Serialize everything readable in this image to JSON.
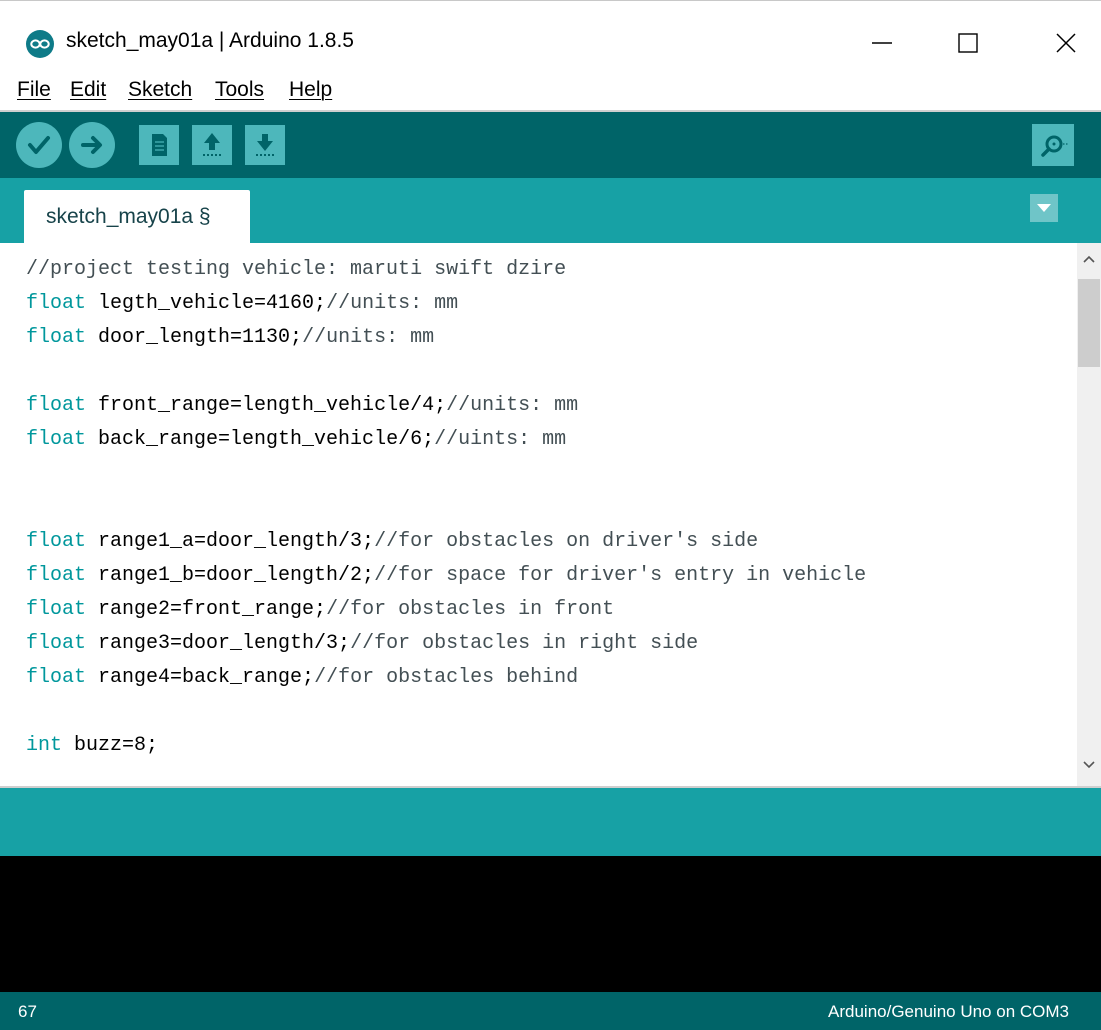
{
  "window": {
    "title": "sketch_may01a | Arduino 1.8.5",
    "app_icon": "arduino-infinity-icon"
  },
  "menu": [
    "File",
    "Edit",
    "Sketch",
    "Tools",
    "Help"
  ],
  "toolbar": {
    "buttons": [
      "verify-icon",
      "upload-icon",
      "new-icon",
      "open-icon",
      "save-icon"
    ],
    "right_button": "serial-monitor-icon"
  },
  "tabs": [
    {
      "label": "sketch_may01a §"
    }
  ],
  "code": [
    "//project testing vehicle: maruti swift dzire",
    "float legth_vehicle=4160;//units: mm",
    "float door_length=1130;//units: mm",
    "",
    "float front_range=length_vehicle/4;//units: mm",
    "float back_range=length_vehicle/6;//uints: mm",
    "",
    "",
    "float range1_a=door_length/3;//for obstacles on driver's side",
    "float range1_b=door_length/2;//for space for driver's entry in vehicle",
    "float range2=front_range;//for obstacles in front",
    "float range3=door_length/3;//for obstacles in right side",
    "float range4=back_range;//for obstacles behind",
    "",
    "int buzz=8;"
  ],
  "status": {
    "line_number": "67",
    "board": "Arduino/Genuino Uno on COM3"
  },
  "colors": {
    "toolbar": "#006468",
    "tabbar": "#17a1a5",
    "button": "#4db7bb",
    "keyword": "#00979c",
    "console": "#000000"
  }
}
